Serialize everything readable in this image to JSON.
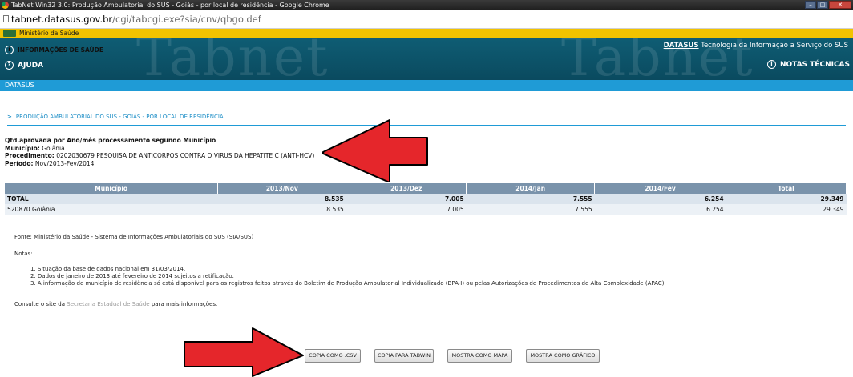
{
  "window": {
    "title": "TabNet Win32 3.0: Produção Ambulatorial do SUS - Goiás - por local de residência - Google Chrome"
  },
  "address": {
    "host": "tabnet.datasus.gov.br",
    "path": "/cgi/tabcgi.exe?sia/cnv/qbgo.def"
  },
  "ministry_bar": {
    "label": "Ministério da Saúde"
  },
  "header": {
    "info_label": "INFORMAÇÕES DE SAÚDE",
    "help_label": "AJUDA",
    "notes_label": "NOTAS TÉCNICAS",
    "datasus_brand": "DATASUS",
    "datasus_tagline": "Tecnologia da Informação a Serviço do SUS",
    "watermark": "Tabnet"
  },
  "subbar": {
    "label": "DATASUS"
  },
  "section_title": "PRODUÇÃO AMBULATORIAL DO SUS - GOIÁS - POR LOCAL DE RESIDÊNCIA",
  "query": {
    "description": "Qtd.aprovada por Ano/mês processamento segundo Município",
    "municipio_label": "Município:",
    "municipio_value": "Goiânia",
    "procedimento_label": "Procedimento:",
    "procedimento_value": "0202030679 PESQUISA DE ANTICORPOS CONTRA O VIRUS DA HEPATITE C (ANTI-HCV)",
    "periodo_label": "Período:",
    "periodo_value": "Nov/2013-Fev/2014"
  },
  "table": {
    "headers": [
      "Município",
      "2013/Nov",
      "2013/Dez",
      "2014/Jan",
      "2014/Fev",
      "Total"
    ],
    "total_row": [
      "TOTAL",
      "8.535",
      "7.005",
      "7.555",
      "6.254",
      "29.349"
    ],
    "rows": [
      [
        "520870 Goiânia",
        "8.535",
        "7.005",
        "7.555",
        "6.254",
        "29.349"
      ]
    ]
  },
  "fonte": "Fonte: Ministério da Saúde - Sistema de Informações Ambulatoriais do SUS (SIA/SUS)",
  "notas_label": "Notas:",
  "notes": [
    "1. Situação da base de dados nacional em 31/03/2014.",
    "2. Dados de janeiro de 2013 até fevereiro de 2014 sujeitos a retificação.",
    "3. A informação de município de residência só está disponível para os registros feitos através do Boletim de Produção Ambulatorial Individualizado (BPA-I) ou pelas Autorizações de Procedimentos de Alta Complexidade (APAC)."
  ],
  "consulte": {
    "prefix": "Consulte o site da",
    "link": "Secretaria Estadual de Saúde",
    "suffix": "para mais informações."
  },
  "buttons": {
    "csv": "COPIA COMO .CSV",
    "tabwin": "COPIA PARA TABWIN",
    "mapa": "MOSTRA COMO MAPA",
    "grafico": "MOSTRA COMO GRÁFICO"
  },
  "colors": {
    "annotation_arrow": "#e5262b",
    "header_bg": "#0f5d74",
    "accent_blue": "#1f9bd6",
    "table_header": "#7a93ab"
  }
}
